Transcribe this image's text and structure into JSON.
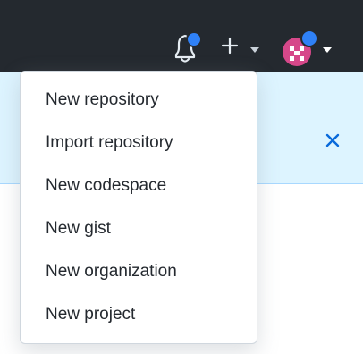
{
  "header": {
    "background": "#24292f",
    "icons": [
      "bell-icon",
      "plus-icon",
      "caret-down-icon",
      "avatar",
      "caret-down-icon"
    ],
    "notification_dot_color": "#2f81f7"
  },
  "banner": {
    "background": "#ddf4ff",
    "close_icon": "close-icon",
    "close_color": "#0969da"
  },
  "dropdown": {
    "items": [
      {
        "label": "New repository"
      },
      {
        "label": "Import repository"
      },
      {
        "label": "New codespace"
      },
      {
        "label": "New gist"
      },
      {
        "label": "New organization"
      },
      {
        "label": "New project"
      }
    ]
  }
}
